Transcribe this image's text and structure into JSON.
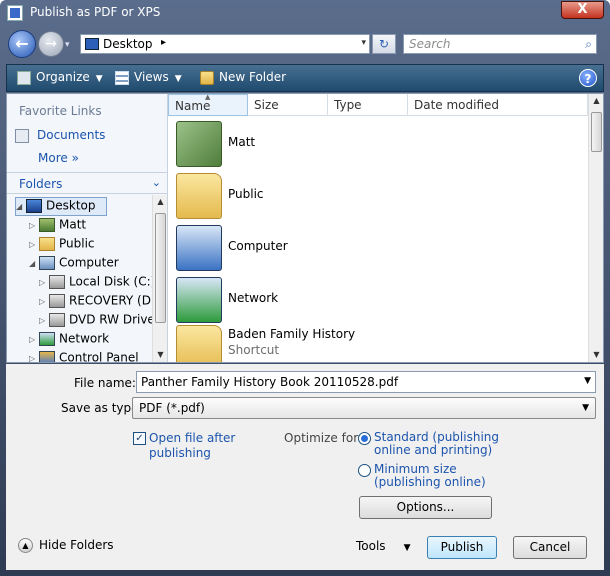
{
  "window": {
    "title": "Publish as PDF or XPS",
    "close_label": "X"
  },
  "nav": {
    "back_glyph": "←",
    "forward_glyph": "→",
    "dropdown_glyph": "▾",
    "address": {
      "location": "Desktop",
      "separator": "▸",
      "dropdown": "▾"
    },
    "refresh_glyph": "↻",
    "search": {
      "placeholder": "Search",
      "icon_glyph": "⌕"
    }
  },
  "toolbar": {
    "organize": "Organize",
    "views": "Views",
    "new_folder": "New Folder",
    "arrow": "▼",
    "help": "?"
  },
  "sidebar": {
    "favorite_links": "Favorite Links",
    "favorites": [
      {
        "label": "Documents"
      }
    ],
    "more": "More  »",
    "folders_header": "Folders",
    "folders_chevron": "⌄",
    "tree": [
      {
        "label": "Desktop",
        "expander": "◢",
        "icon": "desktop-icon"
      },
      {
        "label": "Matt",
        "expander": "▷",
        "icon": "user-folder-icon"
      },
      {
        "label": "Public",
        "expander": "▷",
        "icon": "folder-icon"
      },
      {
        "label": "Computer",
        "expander": "◢",
        "icon": "computer-icon"
      },
      {
        "label": "Local Disk (C:)",
        "expander": "▷",
        "icon": "drive-icon"
      },
      {
        "label": "RECOVERY (D:)",
        "expander": "▷",
        "icon": "drive-icon"
      },
      {
        "label": "DVD RW Drive",
        "expander": "▷",
        "icon": "dvd-drive-icon"
      },
      {
        "label": "Network",
        "expander": "▷",
        "icon": "network-icon"
      },
      {
        "label": "Control Panel",
        "expander": "▷",
        "icon": "control-panel-icon"
      }
    ]
  },
  "columns": [
    "Name",
    "Size",
    "Type",
    "Date modified"
  ],
  "files": [
    {
      "name": "Matt",
      "sub": "",
      "icon": "user-folder-icon"
    },
    {
      "name": "Public",
      "sub": "",
      "icon": "folder-icon"
    },
    {
      "name": "Computer",
      "sub": "",
      "icon": "computer-icon"
    },
    {
      "name": "Network",
      "sub": "",
      "icon": "network-icon"
    },
    {
      "name": "Baden Family History",
      "sub": "Shortcut",
      "icon": "shortcut-folder-icon"
    }
  ],
  "scroll_glyphs": {
    "up": "▲",
    "down": "▼"
  },
  "form": {
    "file_name_label": "File name:",
    "file_name_value": "Panther Family History Book 20110528.pdf",
    "save_as_label": "Save as type:",
    "save_as_value": "PDF (*.pdf)",
    "dropdown": "▼",
    "open_after_label": "Open file after publishing",
    "open_after_checked": "✓",
    "optimize_label": "Optimize for:",
    "standard_label": "Standard (publishing online and printing)",
    "minimum_label": "Minimum size (publishing online)",
    "options_button": "Options...",
    "tools_label": "Tools",
    "tools_dd": "▼",
    "publish_button": "Publish",
    "cancel_button": "Cancel",
    "hide_folders_label": "Hide Folders",
    "hide_folders_glyph": "▲"
  }
}
